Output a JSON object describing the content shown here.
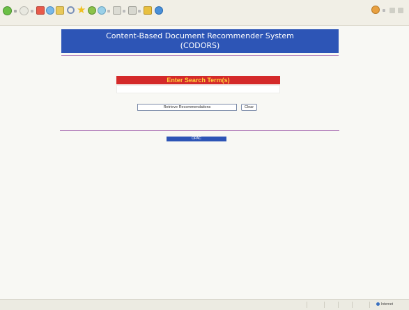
{
  "header": {
    "title_line1": "Content-Based Document Recommender System",
    "title_line2": "(CODORS)"
  },
  "search": {
    "heading": "Enter Search Term(s)",
    "input_value": ""
  },
  "buttons": {
    "retrieve": "Retrieve Recommendations",
    "clear": "Clear",
    "opac": "OPAC"
  },
  "statusbar": {
    "zone": "Internet"
  },
  "toolbar_icons": [
    "back-icon",
    "forward-icon",
    "stop-icon",
    "refresh-icon",
    "home-icon",
    "search-icon",
    "favorites-icon",
    "media-icon",
    "history-icon",
    "mail-icon",
    "print-icon",
    "edit-icon",
    "messenger-icon"
  ],
  "colors": {
    "header_blue": "#2d55b6",
    "search_red": "#d42a2a",
    "search_text_yellow": "#ffd23a",
    "rule_purple": "#b07ab8"
  }
}
